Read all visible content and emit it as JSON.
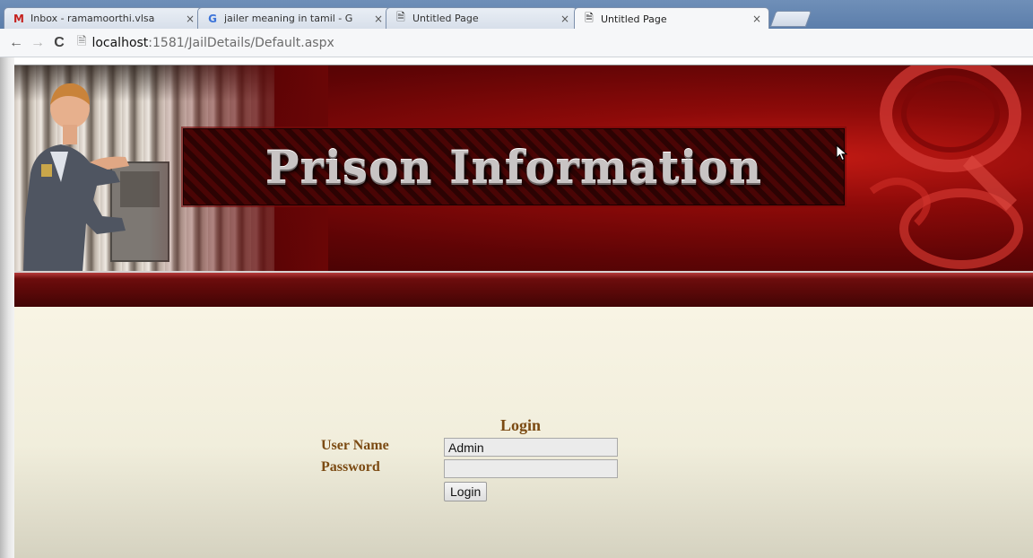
{
  "browser": {
    "tabs": [
      {
        "favicon": "gmail-icon",
        "title": "Inbox - ramamoorthi.vlsa",
        "active": false
      },
      {
        "favicon": "google-icon",
        "title": "jailer meaning in tamil - G",
        "active": false
      },
      {
        "favicon": "page-icon",
        "title": "Untitled Page",
        "active": false
      },
      {
        "favicon": "page-icon",
        "title": "Untitled Page",
        "active": true
      }
    ],
    "close_glyph": "×",
    "url_host": "localhost",
    "url_rest": ":1581/JailDetails/Default.aspx"
  },
  "banner": {
    "title": "Prison Information"
  },
  "login": {
    "heading": "Login",
    "username_label": "User Name",
    "password_label": "Password",
    "username_value": "Admin",
    "password_value": "",
    "button_label": "Login"
  }
}
